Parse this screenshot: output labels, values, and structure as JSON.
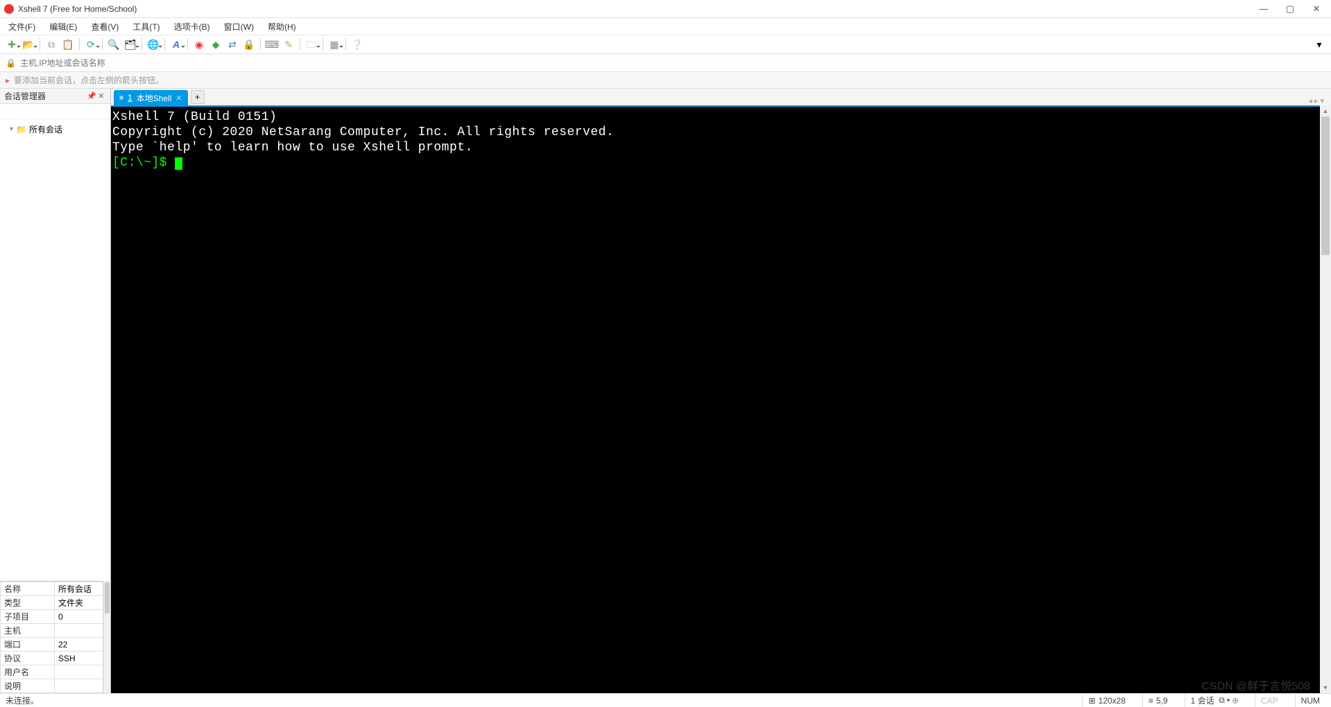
{
  "title": "Xshell 7 (Free for Home/School)",
  "menu": [
    "文件(F)",
    "编辑(E)",
    "查看(V)",
    "工具(T)",
    "选项卡(B)",
    "窗口(W)",
    "帮助(H)"
  ],
  "address_placeholder": "主机,IP地址或会话名称",
  "hint_text": "要添加当前会话，点击左侧的箭头按钮。",
  "session_manager": {
    "title": "会话管理器",
    "root": "所有会话"
  },
  "tab": {
    "num": "1",
    "label": "本地Shell"
  },
  "terminal": {
    "line1": "Xshell 7 (Build 0151)",
    "line2": "Copyright (c) 2020 NetSarang Computer, Inc. All rights reserved.",
    "blank": "",
    "line3": "Type `help' to learn how to use Xshell prompt.",
    "prompt": "[C:\\~]$ "
  },
  "props": [
    {
      "k": "名称",
      "v": "所有会话"
    },
    {
      "k": "类型",
      "v": "文件夹"
    },
    {
      "k": "子项目",
      "v": "0"
    },
    {
      "k": "主机",
      "v": ""
    },
    {
      "k": "端口",
      "v": "22"
    },
    {
      "k": "协议",
      "v": "SSH"
    },
    {
      "k": "用户名",
      "v": ""
    },
    {
      "k": "说明",
      "v": ""
    }
  ],
  "status": {
    "left": "未连接。",
    "size": "120x28",
    "pos": "5,9",
    "sess": "1 会话",
    "cap": "CAP",
    "num": "NUM"
  },
  "watermark": "CSDN @鲜于言悦508"
}
